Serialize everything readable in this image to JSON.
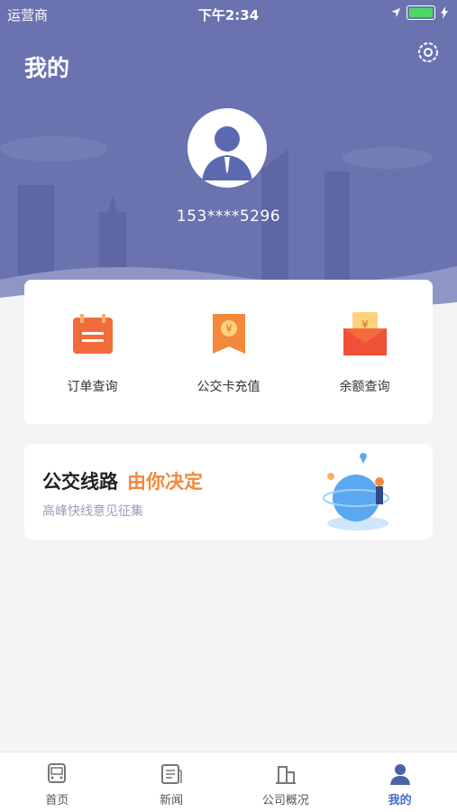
{
  "status_bar": {
    "carrier": "运营商",
    "time": "下午2:34"
  },
  "header": {
    "title": "我的",
    "phone": "153****5296"
  },
  "services": [
    {
      "label": "订单查询",
      "icon": "order-calendar-icon"
    },
    {
      "label": "公交卡充值",
      "icon": "card-recharge-icon"
    },
    {
      "label": "余额查询",
      "icon": "balance-envelope-icon"
    }
  ],
  "banner": {
    "title": "公交线路",
    "accent": "由你决定",
    "subtitle": "高峰快线意见征集"
  },
  "tabs": [
    {
      "label": "首页",
      "icon": "bus-icon"
    },
    {
      "label": "新闻",
      "icon": "news-icon"
    },
    {
      "label": "公司概况",
      "icon": "buildings-icon"
    },
    {
      "label": "我的",
      "icon": "user-icon"
    }
  ],
  "colors": {
    "header": "#6a73b0",
    "accent": "#f5883a",
    "active_tab": "#3e6fcf",
    "battery": "#4cd964"
  }
}
